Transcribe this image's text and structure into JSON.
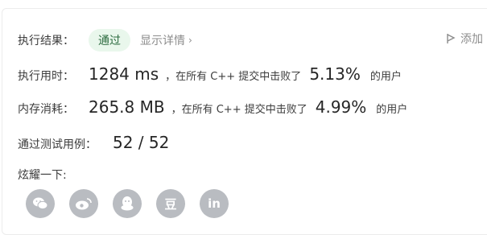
{
  "status": {
    "label": "执行结果：",
    "badge": "通过",
    "details_link": "显示详情",
    "add_label": "添加"
  },
  "runtime": {
    "label": "执行用时：",
    "value": "1284 ms",
    "prefix": "，在所有 C++ 提交中击败了",
    "percent": "5.13%",
    "suffix": "的用户"
  },
  "memory": {
    "label": "内存消耗：",
    "value": "265.8 MB",
    "prefix": "，在所有 C++ 提交中击败了",
    "percent": "4.99%",
    "suffix": "的用户"
  },
  "tests": {
    "label": "通过测试用例：",
    "value": "52 / 52"
  },
  "share": {
    "label": "炫耀一下:",
    "icons": [
      {
        "name": "wechat-icon",
        "glyph": "💬"
      },
      {
        "name": "weibo-icon",
        "glyph": "◎"
      },
      {
        "name": "qq-icon",
        "glyph": "☃"
      },
      {
        "name": "douban-icon",
        "glyph": "豆"
      },
      {
        "name": "linkedin-icon",
        "glyph": "in"
      }
    ]
  },
  "colors": {
    "badge_bg": "#e9f7ec",
    "badge_text": "#2c6b3f",
    "icon_bg": "#b9bcc1"
  }
}
